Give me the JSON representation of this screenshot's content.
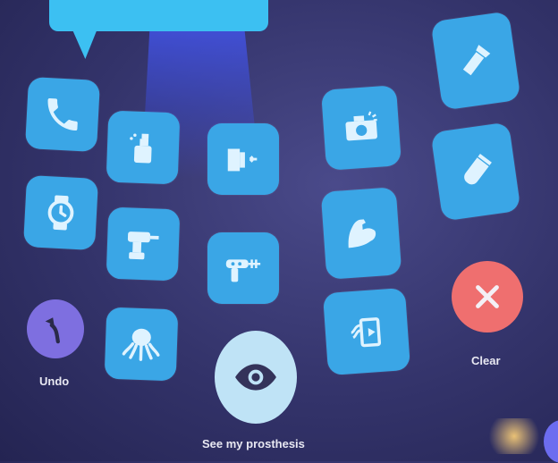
{
  "buttons": {
    "undo_label": "Undo",
    "clear_label": "Clear",
    "see_prosthesis_label": "See my prosthesis"
  },
  "tiles": [
    {
      "icon": "phone-icon"
    },
    {
      "icon": "watch-icon"
    },
    {
      "icon": "spray-bottle-icon"
    },
    {
      "icon": "drill-icon"
    },
    {
      "icon": "octopus-icon"
    },
    {
      "icon": "card-slot-icon"
    },
    {
      "icon": "ray-gun-icon"
    },
    {
      "icon": "camera-icon"
    },
    {
      "icon": "flexed-arm-icon"
    },
    {
      "icon": "media-device-icon"
    },
    {
      "icon": "flashlight-icon"
    },
    {
      "icon": "usb-drive-icon"
    }
  ],
  "colors": {
    "tile": "#3aa6e6",
    "undo": "#7e6fe0",
    "clear": "#ef6f6f",
    "see": "#bfe3f6",
    "background": "#33336a"
  }
}
